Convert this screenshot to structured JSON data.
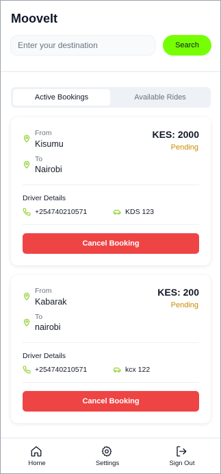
{
  "app": {
    "title": "MooveIt"
  },
  "search": {
    "placeholder": "Enter your destination",
    "button_label": "Search"
  },
  "tabs": [
    {
      "label": "Active Bookings",
      "active": true
    },
    {
      "label": "Available Rides",
      "active": false
    }
  ],
  "bookings": [
    {
      "from_label": "From",
      "from": "Kisumu",
      "to_label": "To",
      "to": "Nairobi",
      "price": "KES: 2000",
      "status": "Pending",
      "driver_details_label": "Driver Details",
      "phone": "+254740210571",
      "plate": "KDS 123",
      "cancel_label": "Cancel Booking"
    },
    {
      "from_label": "From",
      "from": "Kabarak",
      "to_label": "To",
      "to": "nairobi",
      "price": "KES: 200",
      "status": "Pending",
      "driver_details_label": "Driver Details",
      "phone": "+254740210571",
      "plate": "kcx 122",
      "cancel_label": "Cancel Booking"
    }
  ],
  "nav": [
    {
      "label": "Home",
      "icon": "home-icon"
    },
    {
      "label": "Settings",
      "icon": "gear-icon"
    },
    {
      "label": "Sign Out",
      "icon": "sign-out-icon"
    }
  ],
  "colors": {
    "accent": "#76ff03",
    "icon_green": "#84cc16",
    "danger": "#ef4444",
    "pending": "#ca8a04"
  }
}
